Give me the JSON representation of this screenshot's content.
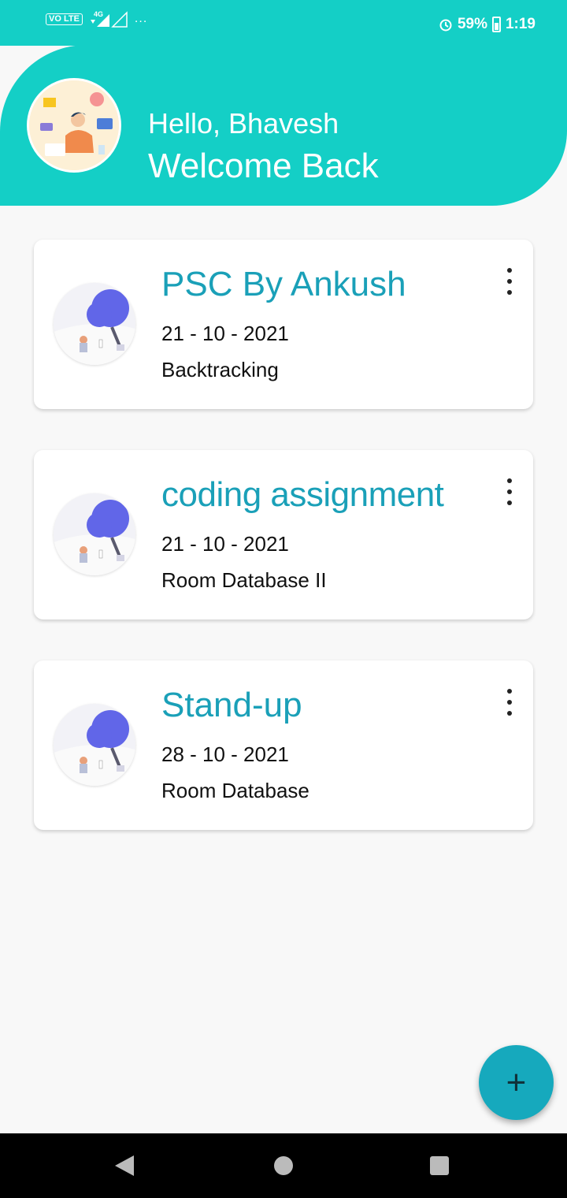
{
  "status_bar": {
    "volte": "VO LTE",
    "network": "4G",
    "more": "...",
    "battery_percent": "59%",
    "time": "1:19"
  },
  "header": {
    "greeting": "Hello, Bhavesh",
    "subtitle": "Welcome Back"
  },
  "cards": [
    {
      "title": "PSC By Ankush",
      "date": "21 - 10 - 2021",
      "subtitle": "Backtracking"
    },
    {
      "title": " coding assignment",
      "date": "21 - 10 - 2021",
      "subtitle": "Room Database II"
    },
    {
      "title": "Stand-up",
      "date": "28 - 10 - 2021",
      "subtitle": "Room Database"
    }
  ],
  "fab": {
    "label": "+"
  },
  "colors": {
    "primary": "#14cfc6",
    "title": "#1aa0b8",
    "fab": "#16a9bd"
  },
  "icons": [
    "alarm-icon",
    "battery-icon",
    "signal-icon",
    "more-vert-icon",
    "add-icon",
    "back-icon",
    "home-icon",
    "recents-icon"
  ]
}
